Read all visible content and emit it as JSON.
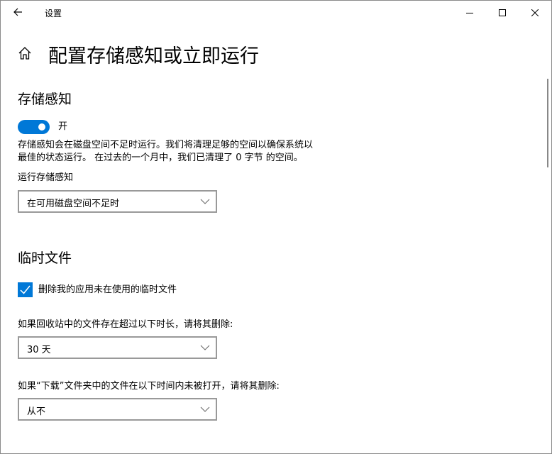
{
  "window": {
    "title": "设置"
  },
  "page": {
    "title": "配置存储感知或立即运行"
  },
  "storage_sense": {
    "heading": "存储感知",
    "toggle_label": "开",
    "toggle_on": true,
    "description_line1": "存储感知会在磁盘空间不足时运行。我们将清理足够的空间以确保系统以",
    "description_line2": "最佳的状态运行。 在过去的一个月中，我们已清理了 0 字节 的空间。",
    "run_label": "运行存储感知",
    "run_value": "在可用磁盘空间不足时"
  },
  "temp_files": {
    "heading": "临时文件",
    "checkbox_label": "删除我的应用未在使用的临时文件",
    "checkbox_checked": true,
    "recycle_label": "如果回收站中的文件存在超过以下时长，请将其删除:",
    "recycle_value": "30 天",
    "downloads_label": "如果“下载”文件夹中的文件在以下时间内未被打开，请将其删除:",
    "downloads_value": "从不"
  }
}
